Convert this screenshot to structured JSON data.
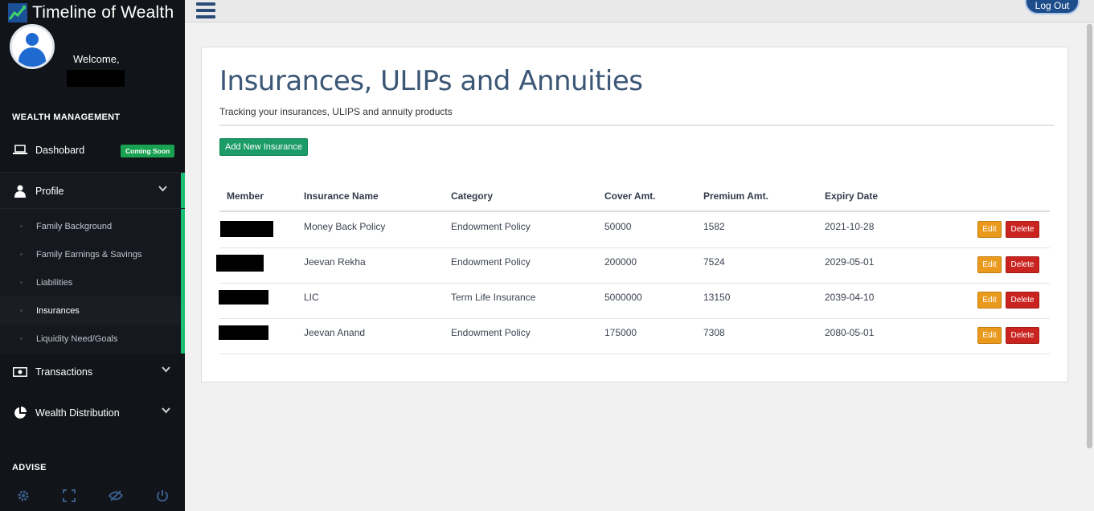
{
  "brand": {
    "title": "Timeline of Wealth"
  },
  "user": {
    "welcome": "Welcome,"
  },
  "sidebar": {
    "section_wealth": "WEALTH MANAGEMENT",
    "section_advise": "ADVISE",
    "dashboard": {
      "label": "Dashobard",
      "badge": "Coming Soon"
    },
    "profile": {
      "label": "Profile"
    },
    "profile_items": [
      {
        "label": "Family Background"
      },
      {
        "label": "Family Earnings & Savings"
      },
      {
        "label": "Liabilities"
      },
      {
        "label": "Insurances"
      },
      {
        "label": "Liquidity Need/Goals"
      }
    ],
    "transactions": {
      "label": "Transactions"
    },
    "wealth_distribution": {
      "label": "Wealth Distribution"
    }
  },
  "topbar": {
    "logout_label": "Log Out"
  },
  "page": {
    "title": "Insurances, ULIPs and Annuities",
    "subtitle": "Tracking your insurances, ULIPS and annuity products",
    "add_button": "Add New Insurance"
  },
  "table": {
    "headers": {
      "member": "Member",
      "name": "Insurance Name",
      "category": "Category",
      "cover": "Cover Amt.",
      "premium": "Premium Amt.",
      "expiry": "Expiry Date"
    },
    "edit_label": "Edit",
    "delete_label": "Delete",
    "rows": [
      {
        "name": "Money Back Policy",
        "category": "Endowment Policy",
        "cover": "50000",
        "premium": "1582",
        "expiry": "2021-10-28"
      },
      {
        "name": "Jeevan Rekha",
        "category": "Endowment Policy",
        "cover": "200000",
        "premium": "7524",
        "expiry": "2029-05-01"
      },
      {
        "name": "LIC",
        "category": "Term Life Insurance",
        "cover": "5000000",
        "premium": "13150",
        "expiry": "2039-04-10"
      },
      {
        "name": "Jeevan Anand",
        "category": "Endowment Policy",
        "cover": "175000",
        "premium": "7308",
        "expiry": "2080-05-01"
      }
    ]
  },
  "colors": {
    "sidebar_bg": "#111419",
    "accent_green": "#1bbf73",
    "title_color": "#3b5775",
    "edit": "#e99a1d",
    "delete": "#c9241f",
    "add": "#1b9c67"
  }
}
